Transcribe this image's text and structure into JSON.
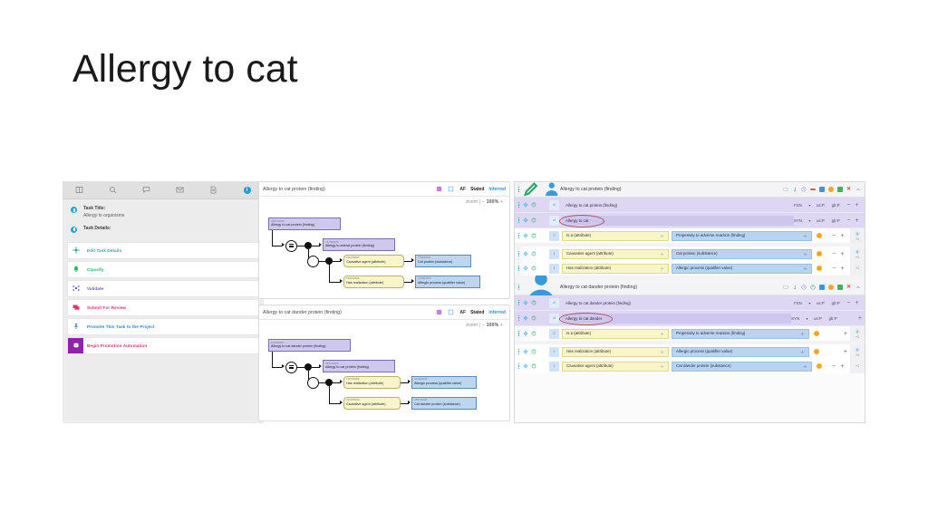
{
  "slide": {
    "title": "Allergy to cat"
  },
  "left_panel": {
    "tabs": [
      {
        "name": "book-icon"
      },
      {
        "name": "search-icon"
      },
      {
        "name": "comment-list-icon"
      },
      {
        "name": "envelope-icon"
      },
      {
        "name": "document-icon"
      },
      {
        "name": "info-icon"
      }
    ],
    "fields": [
      {
        "label": "Task Title:",
        "value": "Allergy to organisms"
      },
      {
        "label": "Task Details:",
        "value": ""
      }
    ],
    "actions": [
      {
        "label": "Edit Task Details",
        "color": "#2aa7a0",
        "icon": "gear-icon"
      },
      {
        "label": "Classify",
        "color": "#19b36b",
        "icon": "bell-icon"
      },
      {
        "label": "Validate",
        "color": "#6b4fc4",
        "icon": "hub-icon"
      },
      {
        "label": "Submit For Review",
        "color": "#e0366b",
        "icon": "chat-icon"
      },
      {
        "label": "Promote This Task to the Project",
        "color": "#2f7fd4",
        "icon": "person-up-icon"
      },
      {
        "label": "Begin Promotion Automation",
        "color": "#e0366b",
        "icon": "robot-icon"
      }
    ]
  },
  "diagrams": [
    {
      "title": "Allergy to cat protein (finding)",
      "mode": {
        "af": "AF",
        "stated": "Stated",
        "inferred": "Inferred"
      },
      "zoom": {
        "label": "zoom |",
        "minus": "−",
        "value": "100%",
        "plus": "+"
      },
      "root": {
        "sctid": "789713006",
        "label": "Allergy to cat protein (finding)"
      },
      "parent": {
        "sctid": "717034006",
        "label": "Allergy to animal protein (finding)"
      },
      "groups": [
        {
          "attr": {
            "sctid": "246075003",
            "label": "Causative agent (attribute)"
          },
          "value": {
            "sctid": "735183001",
            "label": "Cat protein (substance)"
          }
        },
        {
          "attr": {
            "sctid": "719722006",
            "label": "Has realization (attribute)"
          },
          "value": {
            "sctid": "472964009",
            "label": "Allergic process (qualifier value)"
          }
        }
      ]
    },
    {
      "title": "Allergy to cat dander protein (finding)",
      "mode": {
        "af": "AF",
        "stated": "Stated",
        "inferred": "Inferred"
      },
      "zoom": {
        "label": "zoom |",
        "minus": "−",
        "value": "100%",
        "plus": "+"
      },
      "root": {
        "sctid": "232346004",
        "label": "Allergy to cat dander protein (finding)"
      },
      "parent": {
        "sctid": "789713006",
        "label": "Allergy to cat protein (finding)"
      },
      "groups": [
        {
          "attr": {
            "sctid": "719722006",
            "label": "Has realization (attribute)"
          },
          "value": {
            "sctid": "472964009",
            "label": "Allergic process (qualifier value)"
          }
        },
        {
          "attr": {
            "sctid": "246075003",
            "label": "Causative agent (attribute)"
          },
          "value": {
            "sctid": "789711008",
            "label": "Cat dander protein (substance)"
          }
        }
      ]
    }
  ],
  "right_panel": {
    "groups": [
      {
        "title": "Allergy to cat protein (finding)",
        "descriptions": [
          {
            "lang": "ci",
            "term": "Allergy to cat protein (finding)",
            "type": "FSN",
            "us": "us:P",
            "gb": "gb:P",
            "highlight": false,
            "circled": false
          },
          {
            "lang": "ci",
            "term": "Allergy to cat",
            "type": "SYN",
            "us": "us:P",
            "gb": "gb:P",
            "highlight": true,
            "circled": true
          }
        ],
        "relationships": [
          {
            "group": "0",
            "attribute": "Is a (attribute)",
            "value": "Propensity to adverse reaction (finding)",
            "badge": "+1"
          },
          {
            "group": "1",
            "attribute": "Causative agent (attribute)",
            "value": "Cat protein (substance)",
            "badge": "+1"
          },
          {
            "group": "1",
            "attribute": "Has realization (attribute)",
            "value": "Allergic process (qualifier value)",
            "badge": "+1"
          }
        ]
      },
      {
        "title": "Allergy to cat dander protein (finding)",
        "descriptions": [
          {
            "lang": "ci",
            "term": "Allergy to cat dander protein (finding)",
            "type": "FSN",
            "us": "us:P",
            "gb": "gb:P",
            "highlight": false,
            "circled": false
          },
          {
            "lang": "ci",
            "term": "Allergy to cat dander",
            "type": "SYN",
            "us": "us:P",
            "gb": "gb:P",
            "highlight": true,
            "circled": true
          }
        ],
        "relationships": [
          {
            "group": "0",
            "attribute": "Is a (attribute)",
            "value": "Propensity to adverse reaction (finding)",
            "badge": "+1"
          },
          {
            "group": "1",
            "attribute": "Has realization (attribute)",
            "value": "Allergic process (qualifier value)",
            "badge": "+1"
          },
          {
            "group": "1",
            "attribute": "Causative agent (attribute)",
            "value": "Cat dander protein (substance)",
            "badge": "+1"
          }
        ]
      }
    ],
    "controls": {
      "minus": "−",
      "plus": "+",
      "close": "✕"
    }
  }
}
